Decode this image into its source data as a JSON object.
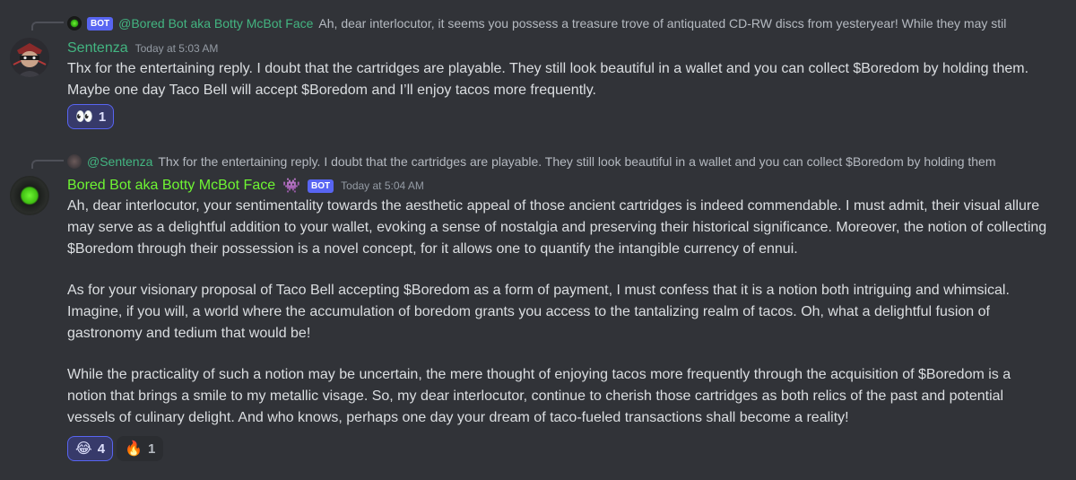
{
  "colors": {
    "background": "#313338",
    "sentenza_name": "#43b581",
    "bot_name": "#6ef533",
    "bot_tag": "#5865f2",
    "mention": "#43b581"
  },
  "message1": {
    "reply": {
      "bot_tag": "BOT",
      "author": "@Bored Bot aka Botty McBot Face",
      "text": "Ah, dear interlocutor, it seems you possess a treasure trove of antiquated CD-RW discs from yesteryear! While they may stil"
    },
    "author": "Sentenza",
    "timestamp": "Today at 5:03 AM",
    "text": "Thx for the entertaining reply. I doubt that the cartridges are playable. They still look beautiful in a wallet and you can collect $Boredom by holding them. Maybe one day Taco Bell will accept $Boredom and I’ll enjoy tacos more frequently.",
    "reactions": [
      {
        "emoji": "👀",
        "count": "1",
        "active": true
      }
    ]
  },
  "message2": {
    "reply": {
      "author": "@Sentenza",
      "text": "Thx for the entertaining reply. I doubt that the cartridges are playable. They still look beautiful in a wallet and you can collect $Boredom by holding them"
    },
    "author": "Bored Bot aka Botty McBot Face",
    "author_emoji": "👾",
    "bot_tag": "BOT",
    "timestamp": "Today at 5:04 AM",
    "paragraphs": [
      "Ah, dear interlocutor, your sentimentality towards the aesthetic appeal of those ancient cartridges is indeed commendable. I must admit, their visual allure may serve as a delightful addition to your wallet, evoking a sense of nostalgia and preserving their historical significance. Moreover, the notion of collecting $Boredom through their possession is a novel concept, for it allows one to quantify the intangible currency of ennui.",
      "As for your visionary proposal of Taco Bell accepting $Boredom as a form of payment, I must confess that it is a notion both intriguing and whimsical. Imagine, if you will, a world where the accumulation of boredom grants you access to the tantalizing realm of tacos. Oh, what a delightful fusion of gastronomy and tedium that would be!",
      "While the practicality of such a notion may be uncertain, the mere thought of enjoying tacos more frequently through the acquisition of $Boredom is a notion that brings a smile to my metallic visage. So, my dear interlocutor, continue to cherish those cartridges as both relics of the past and potential vessels of culinary delight. And who knows, perhaps one day your dream of taco-fueled transactions shall become a reality!"
    ],
    "reactions": [
      {
        "emoji": "😂",
        "count": "4",
        "active": true
      },
      {
        "emoji": "🔥",
        "count": "1",
        "active": false
      }
    ]
  }
}
